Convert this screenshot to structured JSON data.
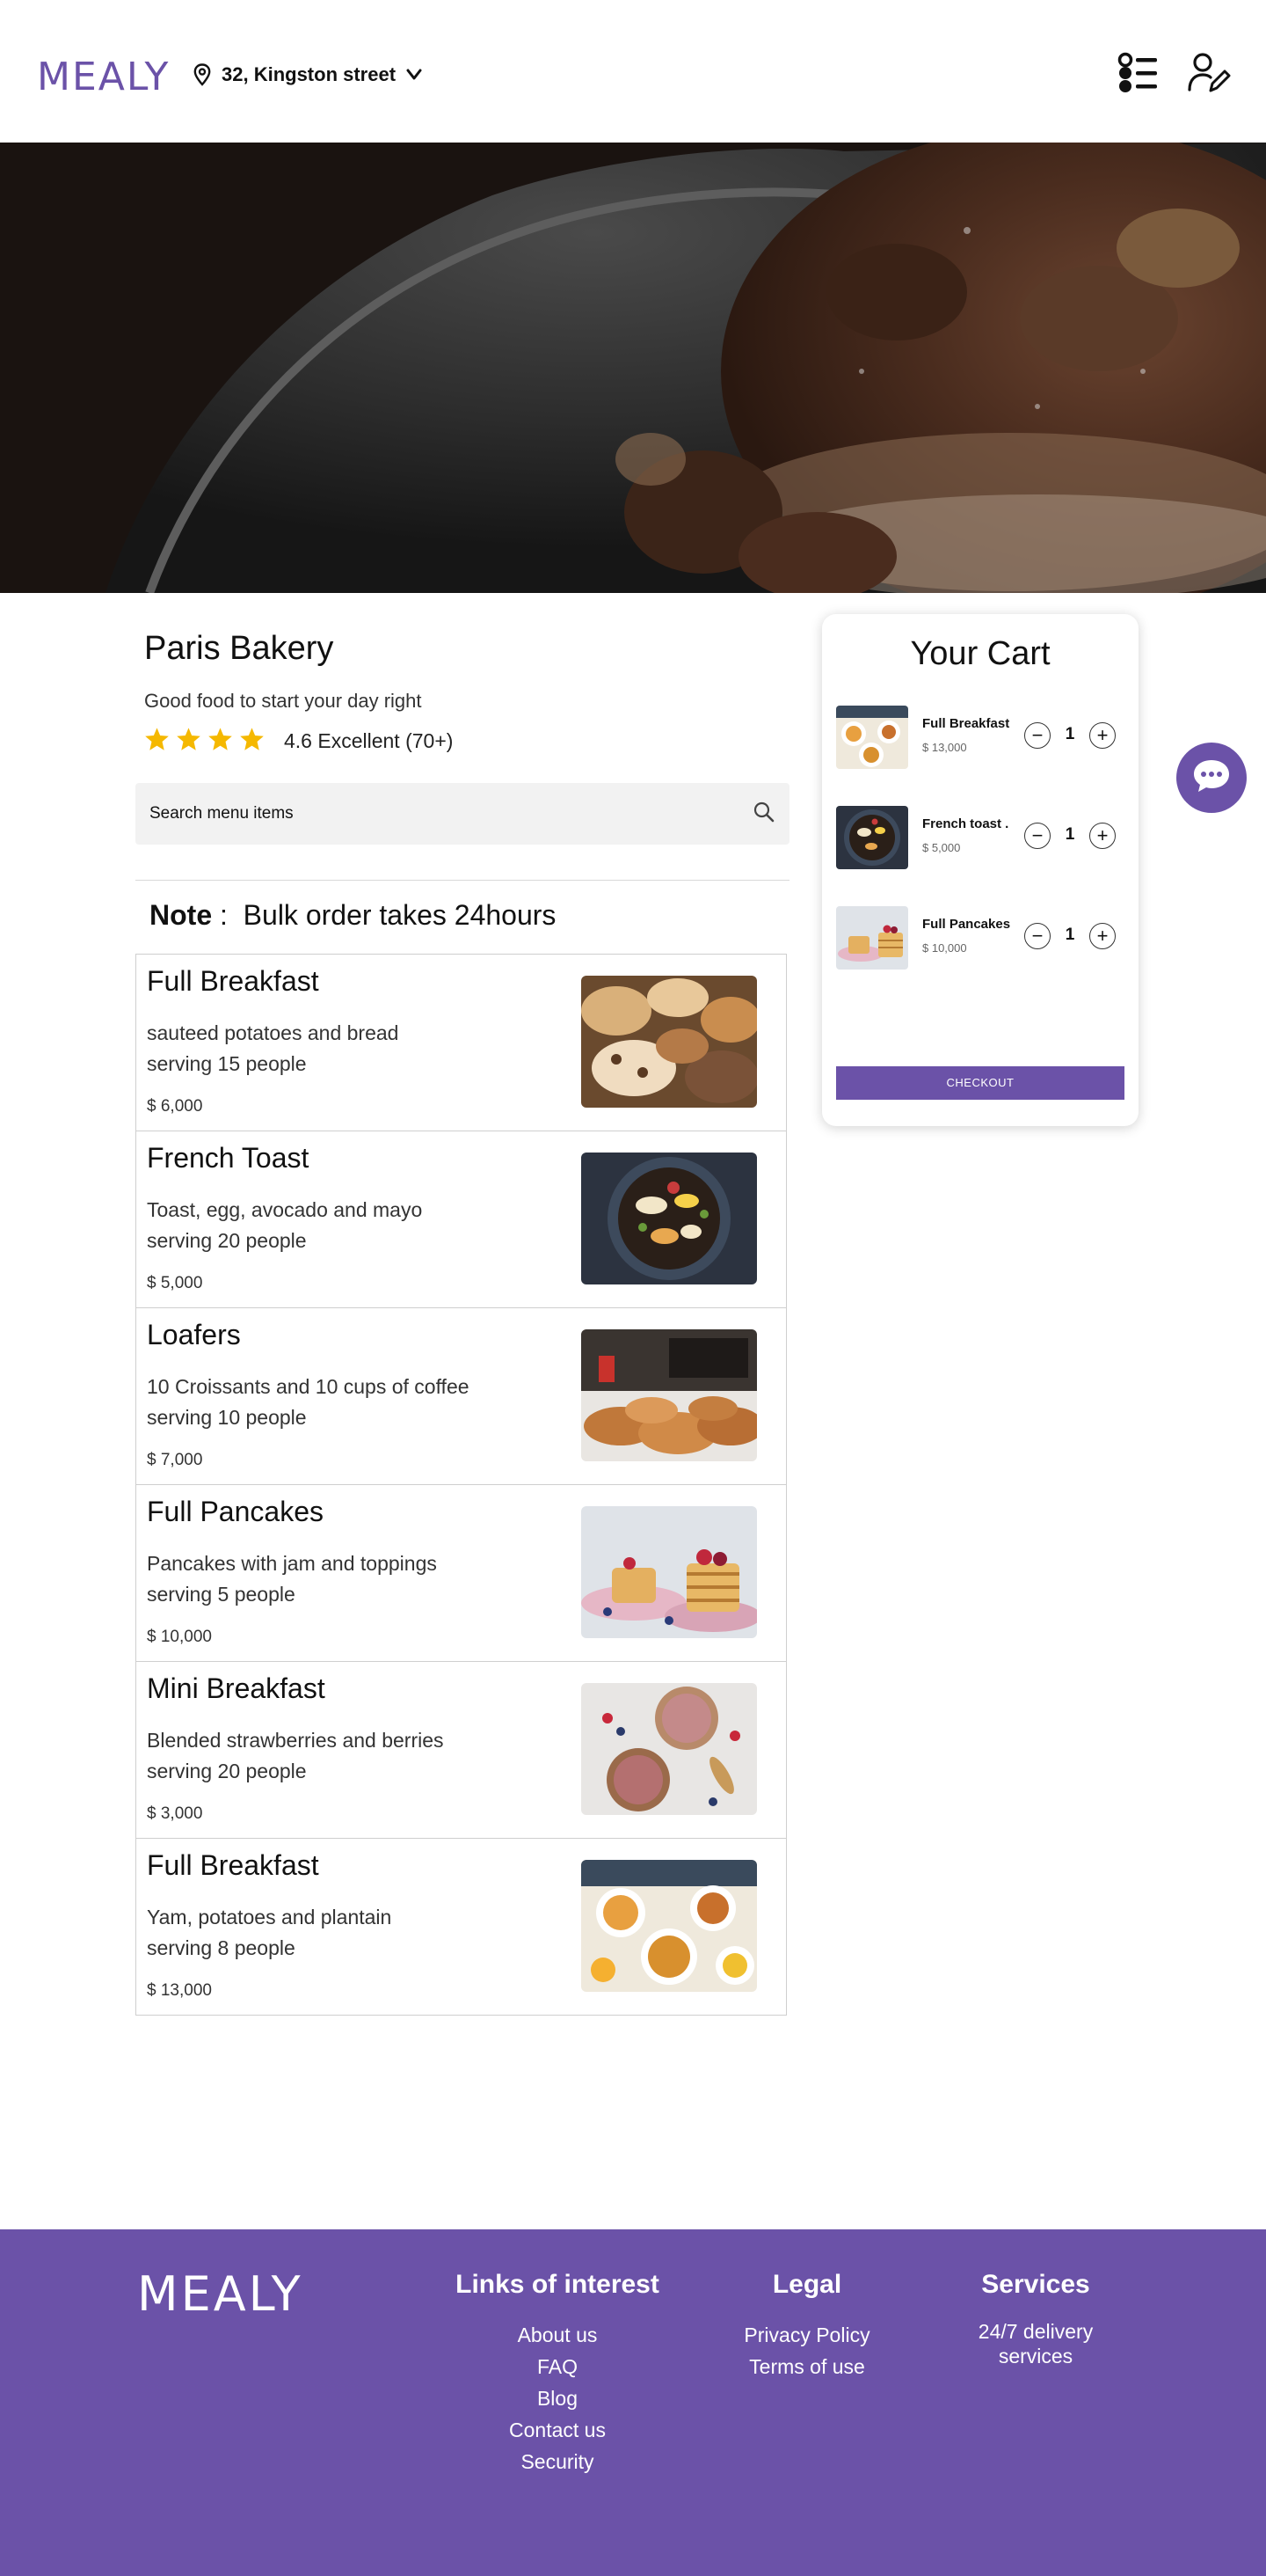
{
  "header": {
    "logo": "MEALY",
    "location": "32, Kingston street",
    "icons": [
      "location-pin-icon",
      "chevron-down-icon",
      "order-list-icon",
      "user-edit-icon"
    ]
  },
  "restaurant": {
    "name": "Paris Bakery",
    "tagline": "Good food to start your day right",
    "stars": 4,
    "rating_text": "4.6 Excellent (70+)"
  },
  "search": {
    "placeholder": "Search menu items"
  },
  "note": {
    "label": "Note",
    "separator": ":",
    "text": "Bulk order takes 24hours"
  },
  "menu": {
    "items": [
      {
        "name": "Full Breakfast",
        "desc1": "sauteed potatoes and bread",
        "desc2": "serving 15 people",
        "price": "$ 6,000"
      },
      {
        "name": "French Toast",
        "desc1": "Toast, egg, avocado and mayo",
        "desc2": "serving 20 people",
        "price": "$ 5,000"
      },
      {
        "name": "Loafers",
        "desc1": "10 Croissants and 10 cups of coffee",
        "desc2": "serving 10 people",
        "price": "$ 7,000"
      },
      {
        "name": "Full Pancakes",
        "desc1": "Pancakes with jam and toppings",
        "desc2": "serving 5 people",
        "price": "$ 10,000"
      },
      {
        "name": "Mini Breakfast",
        "desc1": "Blended strawberries and berries",
        "desc2": "serving 20 people",
        "price": "$ 3,000"
      },
      {
        "name": "Full Breakfast",
        "desc1": "Yam, potatoes and plantain",
        "desc2": "serving 8 people",
        "price": "$ 13,000"
      }
    ]
  },
  "cart": {
    "title": "Your Cart",
    "items": [
      {
        "name": "Full Breakfast",
        "price": "$ 13,000",
        "qty": "1"
      },
      {
        "name": "French toast  .",
        "price": "$ 5,000",
        "qty": "1"
      },
      {
        "name": "Full Pancakes",
        "price": "$ 10,000",
        "qty": "1"
      }
    ],
    "minus": "−",
    "plus": "+",
    "checkout": "CHECKOUT"
  },
  "footer": {
    "logo": "MEALY",
    "links_title": "Links of interest",
    "links": [
      "About us",
      "FAQ",
      "Blog",
      "Contact us",
      "Security"
    ],
    "legal_title": "Legal",
    "legal": [
      "Privacy Policy",
      "Terms of use"
    ],
    "services_title": "Services",
    "services_line1": "24/7 delivery",
    "services_line2": "services"
  },
  "colors": {
    "brand": "#6b52a8",
    "star": "#f5b800",
    "search_bg": "#f2f2f2"
  }
}
